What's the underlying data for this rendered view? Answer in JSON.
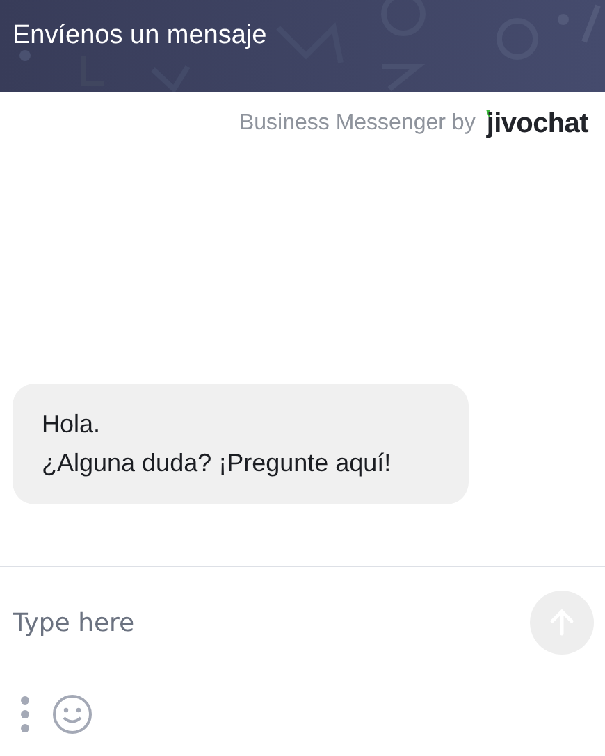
{
  "header": {
    "title": "Envíenos un mensaje"
  },
  "branding": {
    "caption": "Business Messenger by",
    "logo": "jivochat"
  },
  "messages": [
    {
      "text": "Hola.\n¿Alguna duda? ¡Pregunte aquí!"
    }
  ],
  "composer": {
    "placeholder": "Type here"
  }
}
